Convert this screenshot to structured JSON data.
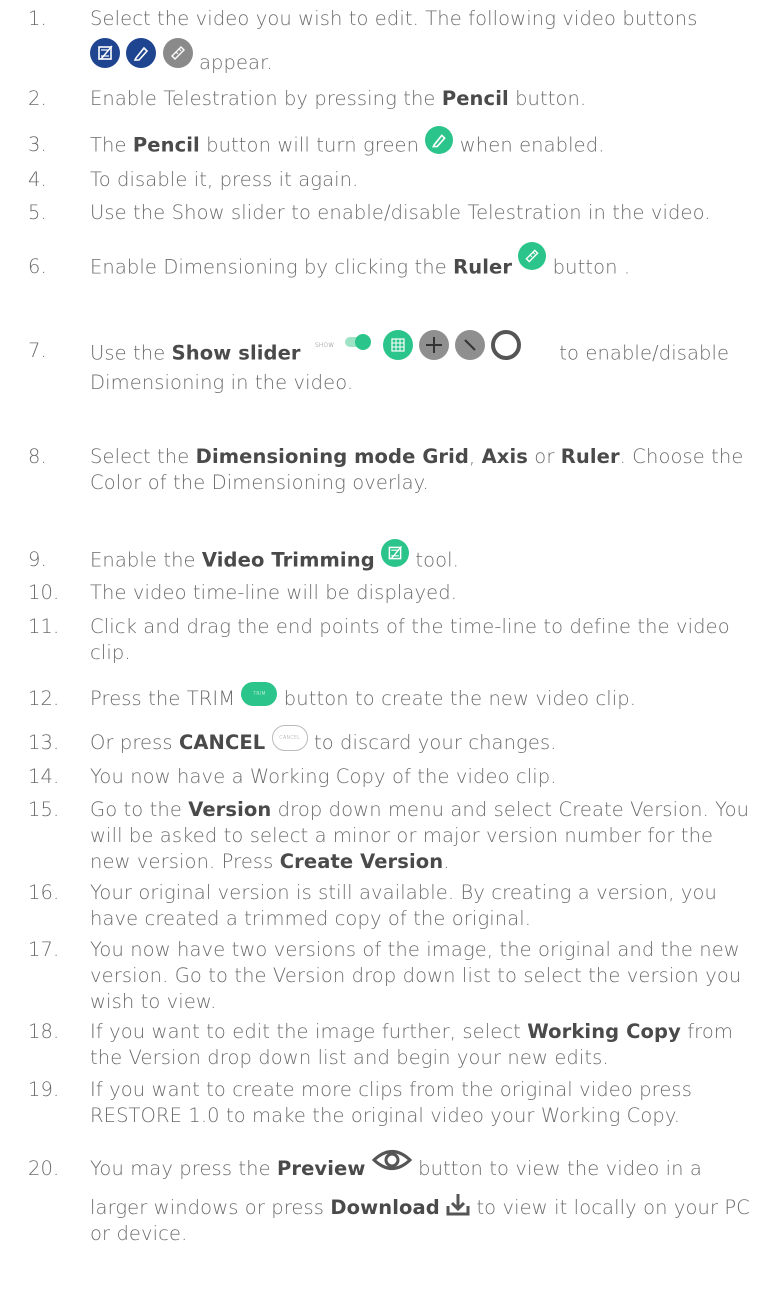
{
  "steps": [
    {
      "n": "1.",
      "parts": [
        "Select the video you wish to edit. The following video buttons",
        "appear."
      ]
    },
    {
      "n": "2.",
      "parts": [
        "Enable Telestration by pressing the ",
        "Pencil",
        " button."
      ]
    },
    {
      "n": "3.",
      "parts": [
        " The ",
        "Pencil",
        " button will turn green ",
        "when enabled."
      ]
    },
    {
      "n": "4.",
      "parts": [
        "To disable it, press it again."
      ]
    },
    {
      "n": "5.",
      "parts": [
        "Use the Show slider to enable/disable Telestration in the video."
      ]
    },
    {
      "n": "6.",
      "parts": [
        "Enable Dimensioning by clicking the ",
        "Ruler",
        " button ."
      ]
    },
    {
      "n": "7.",
      "parts": [
        "Use the ",
        "Show slider",
        " to enable/disable",
        "Dimensioning in the video."
      ]
    },
    {
      "n": "8.",
      "parts": [
        "Select the ",
        "Dimensioning mode Grid",
        ", ",
        "Axis",
        " or ",
        "Ruler",
        ". Choose the",
        "Color of the Dimensioning overlay."
      ]
    },
    {
      "n": "9.",
      "parts": [
        "Enable the ",
        "Video Trimming",
        " tool."
      ]
    },
    {
      "n": "10.",
      "parts": [
        "The video time-line will be displayed."
      ]
    },
    {
      "n": "11.",
      "parts": [
        "Click and drag the end points of the time-line to define the video",
        "clip."
      ]
    },
    {
      "n": "12.",
      "parts": [
        "Press the TRIM ",
        "button to create the new video clip."
      ]
    },
    {
      "n": "13.",
      "parts": [
        "Or press ",
        "CANCEL",
        " to discard your changes."
      ]
    },
    {
      "n": "14.",
      "parts": [
        "You now have a Working Copy of the video clip."
      ]
    },
    {
      "n": "15.",
      "parts": [
        "Go to the ",
        "Version",
        " drop down menu and select Create Version. You",
        "will be asked to select a minor or major version number for the",
        "new version. Press ",
        "Create Version",
        "."
      ]
    },
    {
      "n": "16.",
      "parts": [
        "Your original version is still available. By creating a version, you",
        "have created a trimmed copy of the original."
      ]
    },
    {
      "n": "17.",
      "parts": [
        "You now have two versions of the image, the original and the new",
        "version. Go to the Version drop down list to select the version you",
        "wish to view."
      ]
    },
    {
      "n": "18.",
      "parts": [
        "If you want to edit the image further, select ",
        "Working Copy",
        " from",
        "the Version drop down list and begin your new edits."
      ]
    },
    {
      "n": "19.",
      "parts": [
        "If you want to create more clips from the original video press",
        "RESTORE 1.0 to make the original video your Working Copy."
      ]
    },
    {
      "n": "20.",
      "parts": [
        "You may press the ",
        "Preview",
        " button to view the video in a",
        "larger windows or press ",
        "Download",
        " to view it locally on your PC",
        "or device."
      ]
    }
  ],
  "icons": {
    "show_label": "SHOW",
    "trim_label": "TRIM",
    "cancel_label": "CANCEL",
    "colors": {
      "navy": "#1f4590",
      "green": "#2bc48a",
      "grey": "#8a8a8a",
      "text": "#6b6b6b"
    }
  }
}
